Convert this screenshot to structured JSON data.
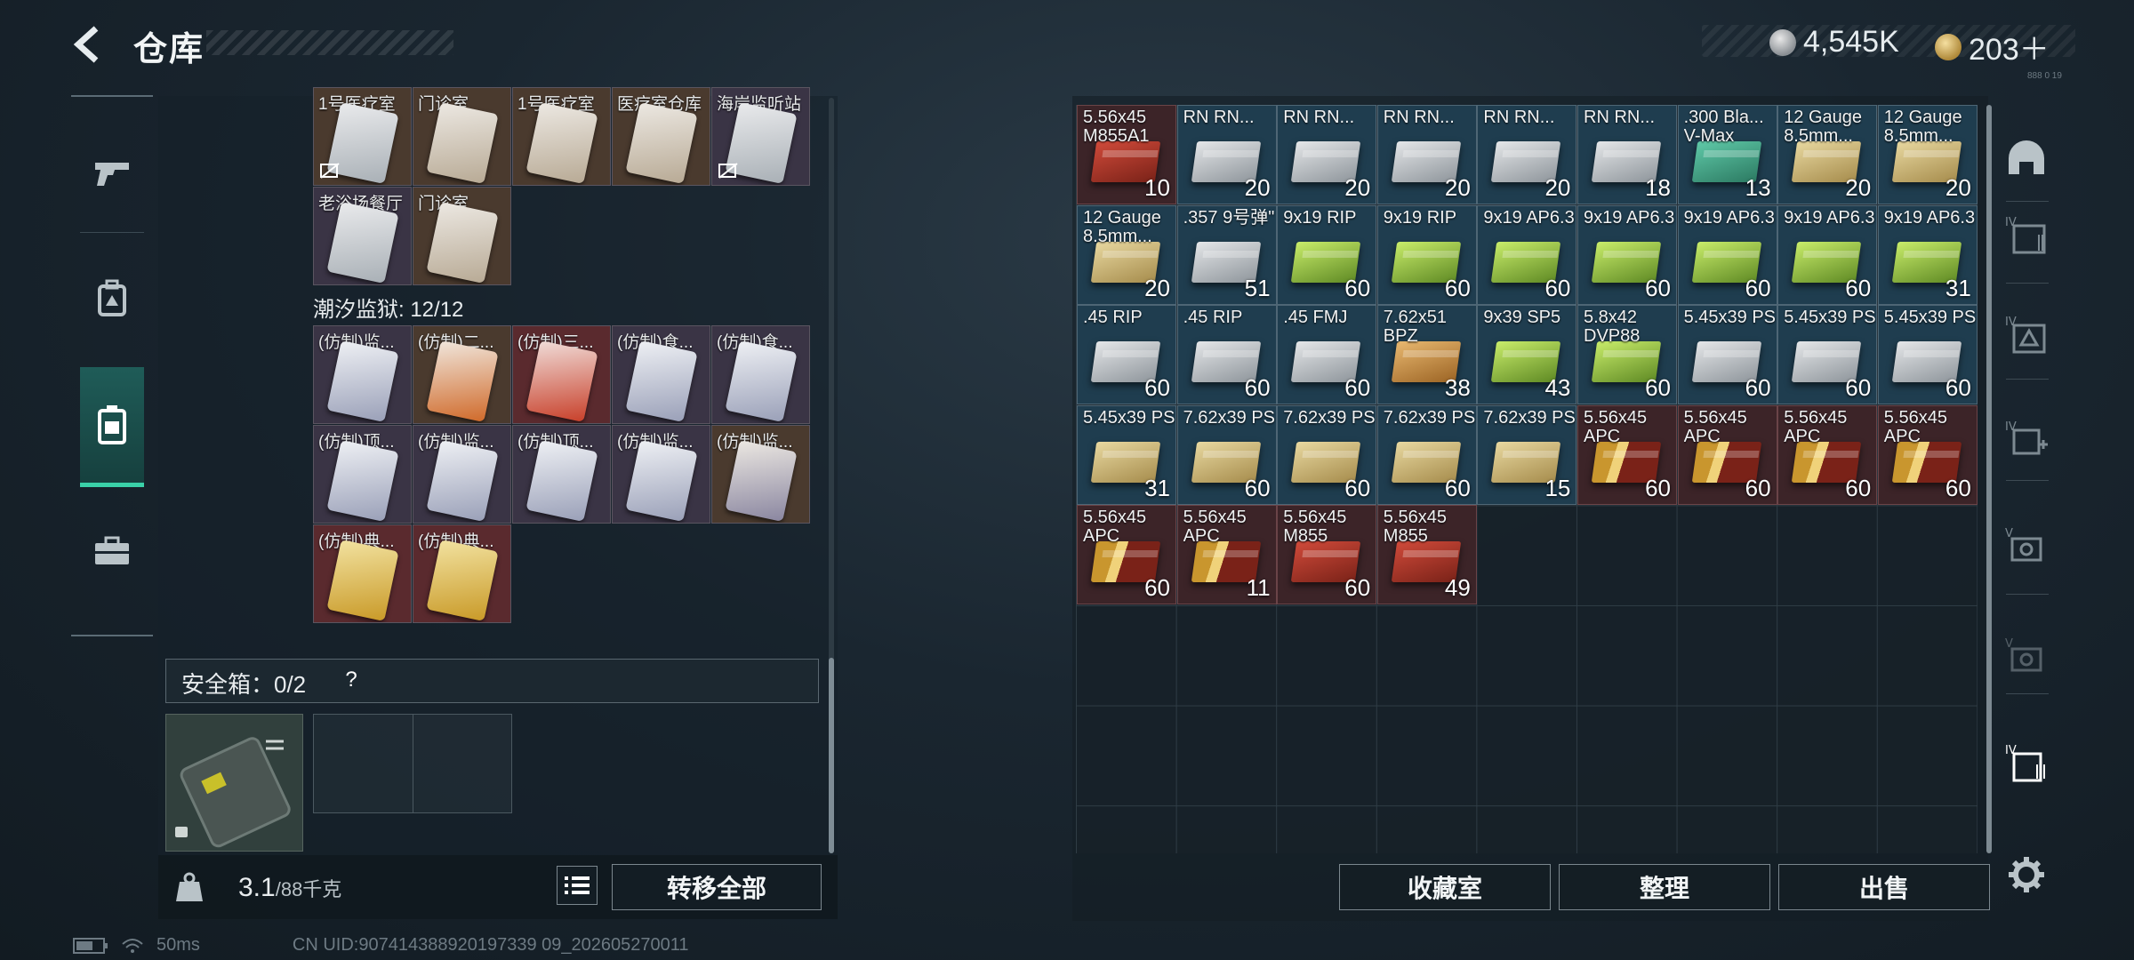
{
  "header": {
    "title": "仓库"
  },
  "currency": {
    "silver": "4,545K",
    "gold": "203＋",
    "version": "888 0 19"
  },
  "nav": {
    "items": [
      "weapons",
      "backpack",
      "storage",
      "toolbox"
    ],
    "active": 2
  },
  "left": {
    "top_row_labels": [
      "1号医疗室",
      "门诊室",
      "1号医疗室",
      "医疗室仓库",
      "海岸监听站"
    ],
    "row2_labels": [
      "老浴场餐厅",
      "门诊室"
    ],
    "section_label": "潮汐监狱: 12/12",
    "prison_rows": [
      [
        "(仿制)监...",
        "(仿制)二...",
        "(仿制)三...",
        "(仿制)食...",
        "(仿制)食..."
      ],
      [
        "(仿制)顶...",
        "(仿制)监...",
        "(仿制)顶...",
        "(仿制)监...",
        "(仿制)监..."
      ],
      [
        "(仿制)典...",
        "(仿制)典..."
      ]
    ],
    "safe_label": "安全箱：0/2",
    "safe_help": "?",
    "weight_value": "3.1",
    "weight_unit": "/88千克",
    "transfer_all": "转移全部"
  },
  "ammo": [
    {
      "t": "5.56x45 M855A1",
      "q": "10",
      "c": "red"
    },
    {
      "t": "RN RN...",
      "q": "20",
      "c": "silver"
    },
    {
      "t": "RN RN...",
      "q": "20",
      "c": "silver"
    },
    {
      "t": "RN RN...",
      "q": "20",
      "c": "silver"
    },
    {
      "t": "RN RN...",
      "q": "20",
      "c": "silver"
    },
    {
      "t": "RN RN...",
      "q": "18",
      "c": "silver"
    },
    {
      "t": ".300 Bla... V-Max",
      "q": "13",
      "c": "teal"
    },
    {
      "t": "12 Gauge 8.5mm...",
      "q": "20",
      "c": "sand"
    },
    {
      "t": "12 Gauge 8.5mm...",
      "q": "20",
      "c": "sand"
    },
    {
      "t": "12 Gauge 8.5mm...",
      "q": "20",
      "c": "sand"
    },
    {
      "t": ".357 9号弹\"",
      "q": "51",
      "c": "silver"
    },
    {
      "t": "9x19 RIP",
      "q": "60",
      "c": "lime"
    },
    {
      "t": "9x19 RIP",
      "q": "60",
      "c": "lime"
    },
    {
      "t": "9x19 AP6.3",
      "q": "60",
      "c": "lime"
    },
    {
      "t": "9x19 AP6.3",
      "q": "60",
      "c": "lime"
    },
    {
      "t": "9x19 AP6.3",
      "q": "60",
      "c": "lime"
    },
    {
      "t": "9x19 AP6.3",
      "q": "60",
      "c": "lime"
    },
    {
      "t": "9x19 AP6.3",
      "q": "31",
      "c": "lime"
    },
    {
      "t": ".45 RIP",
      "q": "60",
      "c": "silver"
    },
    {
      "t": ".45 RIP",
      "q": "60",
      "c": "silver"
    },
    {
      "t": ".45 FMJ",
      "q": "60",
      "c": "silver"
    },
    {
      "t": "7.62x51 BPZ",
      "q": "38",
      "c": "orange"
    },
    {
      "t": "9x39 SP5",
      "q": "43",
      "c": "lime"
    },
    {
      "t": "5.8x42 DVP88",
      "q": "60",
      "c": "lime"
    },
    {
      "t": "5.45x39 PS",
      "q": "60",
      "c": "silver"
    },
    {
      "t": "5.45x39 PS",
      "q": "60",
      "c": "silver"
    },
    {
      "t": "5.45x39 PS",
      "q": "60",
      "c": "silver"
    },
    {
      "t": "5.45x39 PS",
      "q": "31",
      "c": "sand"
    },
    {
      "t": "7.62x39 PS",
      "q": "60",
      "c": "sand"
    },
    {
      "t": "7.62x39 PS",
      "q": "60",
      "c": "sand"
    },
    {
      "t": "7.62x39 PS",
      "q": "60",
      "c": "sand"
    },
    {
      "t": "7.62x39 PS",
      "q": "15",
      "c": "sand"
    },
    {
      "t": "5.56x45 APC",
      "q": "60",
      "c": "bullet"
    },
    {
      "t": "5.56x45 APC",
      "q": "60",
      "c": "bullet"
    },
    {
      "t": "5.56x45 APC",
      "q": "60",
      "c": "bullet"
    },
    {
      "t": "5.56x45 APC",
      "q": "60",
      "c": "bullet"
    },
    {
      "t": "5.56x45 APC",
      "q": "60",
      "c": "bullet"
    },
    {
      "t": "5.56x45 APC",
      "q": "11",
      "c": "bullet"
    },
    {
      "t": "5.56x45 M855",
      "q": "60",
      "c": "red"
    },
    {
      "t": "5.56x45 M855",
      "q": "49",
      "c": "red"
    }
  ],
  "buttons": {
    "collection": "收藏室",
    "sort": "整理",
    "sell": "出售"
  },
  "footer": {
    "ping": "50ms",
    "uid": "CN UID:907414388920197339 09_202605270011"
  },
  "colors": {
    "accent": "#3ad1a8",
    "cell_blue": "#1f3d4f",
    "cell_red": "#3c2428"
  }
}
